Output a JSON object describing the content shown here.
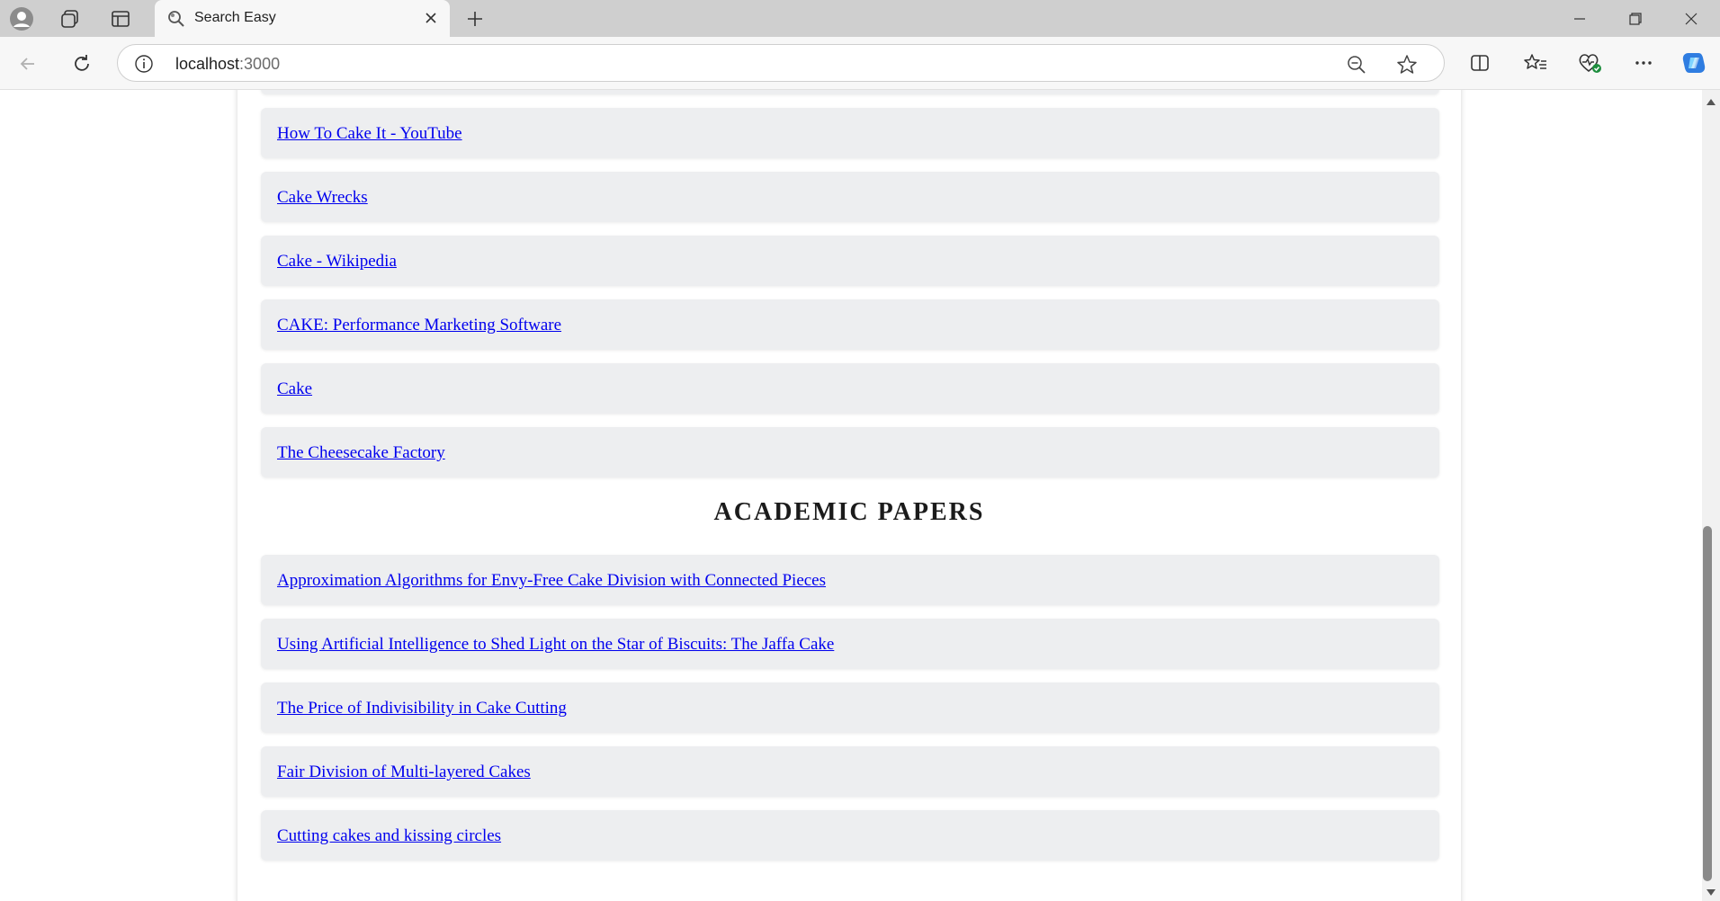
{
  "browser": {
    "tab_title": "Search Easy",
    "url_host": "localhost",
    "url_port": ":3000"
  },
  "web_results": [
    "How To Cake It - YouTube",
    "Cake Wrecks",
    "Cake - Wikipedia",
    "CAKE: Performance Marketing Software",
    "Cake",
    "The Cheesecake Factory"
  ],
  "academic_title": "ACADEMIC PAPERS",
  "academic_results": [
    "Approximation Algorithms for Envy-Free Cake Division with Connected Pieces",
    "Using Artificial Intelligence to Shed Light on the Star of Biscuits: The Jaffa Cake",
    "The Price of Indivisibility in Cake Cutting",
    "Fair Division of Multi-layered Cakes",
    "Cutting cakes and kissing circles"
  ],
  "colors": {
    "link": "#0000ee",
    "result_bg": "#edeef0",
    "accent": "#2f7de1"
  },
  "icons": {
    "profile": "profile-icon",
    "workspaces": "workspaces-icon",
    "tab_actions": "tab-actions-icon",
    "site": "search-easy-favicon",
    "close": "close-icon",
    "new_tab": "plus-icon",
    "back": "back-arrow-icon",
    "refresh": "refresh-icon",
    "info": "info-icon",
    "zoom": "zoom-out-icon",
    "favorite": "star-icon",
    "split": "split-screen-icon",
    "favorites": "favorites-icon",
    "health": "browser-essentials-icon",
    "more": "more-icon",
    "copilot": "copilot-icon"
  }
}
